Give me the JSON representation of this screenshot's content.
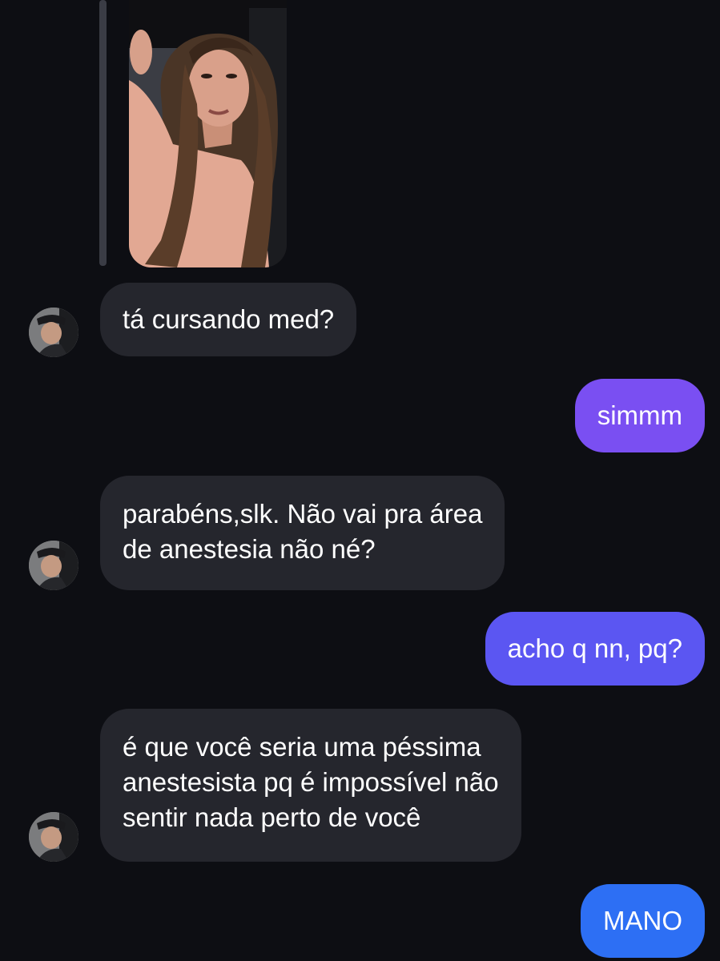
{
  "conversation": {
    "messages": [
      {
        "sender": "them",
        "text": "tá cursando med?"
      },
      {
        "sender": "me",
        "text": "simmm"
      },
      {
        "sender": "them",
        "lines": [
          "parabéns,slk. Não vai pra área",
          "de anestesia não né?"
        ]
      },
      {
        "sender": "me",
        "text": "acho q nn, pq?"
      },
      {
        "sender": "them",
        "lines": [
          "é que você seria uma péssima",
          "anestesista pq é impossível não",
          "sentir nada perto de você"
        ]
      },
      {
        "sender": "me",
        "text": "MANO"
      }
    ]
  },
  "shared_photo": {
    "icon": "photo-selfie-icon"
  },
  "colors": {
    "background": "#0d0e13",
    "incoming_bubble": "#25262d",
    "outgoing_1": "#7a4ff2",
    "outgoing_2": "#5b56f2",
    "outgoing_3": "#2d6ff4",
    "reply_bar": "#3a3c45"
  },
  "icons": {
    "avatar": "avatar-icon"
  }
}
